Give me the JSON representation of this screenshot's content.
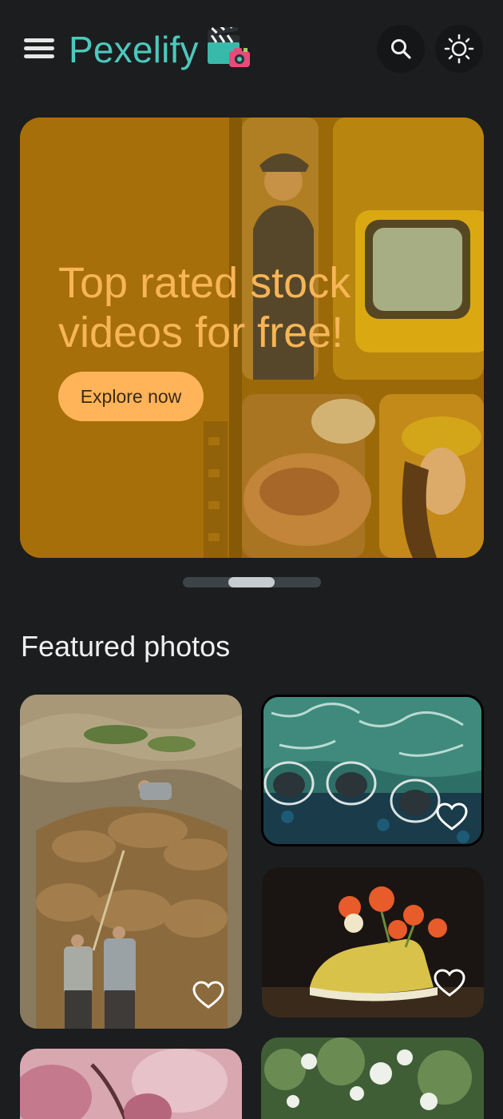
{
  "app": {
    "name": "Pexelify"
  },
  "header": {
    "menu_icon": "hamburger-menu-icon",
    "logo_icon": "clapperboard-camera-icon",
    "search_icon": "search-icon",
    "theme_icon": "sun-icon"
  },
  "hero": {
    "title_line1": "Top rated stock",
    "title_line2": "videos for free!",
    "button_label": "Explore now"
  },
  "carousel": {
    "slides": 3,
    "active_index": 1
  },
  "featured": {
    "title": "Featured photos",
    "photos": [
      {
        "subject": "hay stack with workers",
        "favorite_icon": "heart-outline-icon"
      },
      {
        "subject": "aerial ocean with circular platforms",
        "favorite_icon": "heart-outline-icon"
      },
      {
        "subject": "yellow sneakers with flowers",
        "favorite_icon": "heart-outline-icon"
      },
      {
        "subject": "pink blossoms",
        "favorite_icon": "heart-outline-icon"
      },
      {
        "subject": "white flowering bush",
        "favorite_icon": "heart-outline-icon"
      }
    ]
  },
  "colors": {
    "background": "#1b1d1e",
    "logo": "#4cc9be",
    "hero_text": "#f7b556",
    "hero_button": "#ffb45a"
  }
}
